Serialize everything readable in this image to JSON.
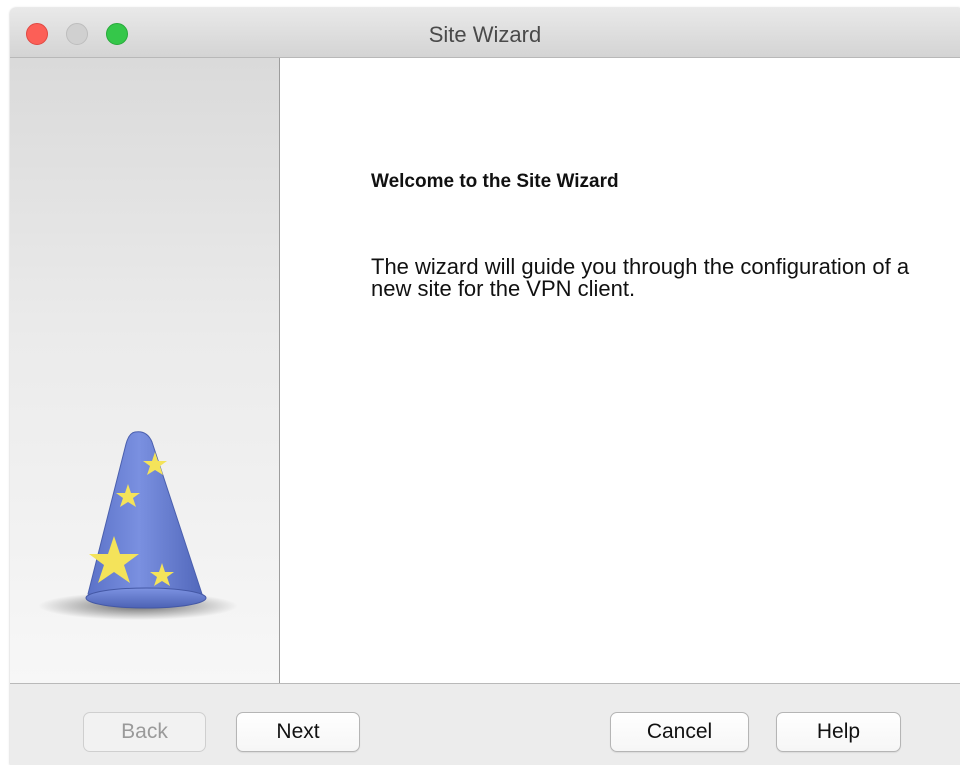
{
  "window": {
    "title": "Site Wizard"
  },
  "side_panel": {
    "illustration": "wizard-hat-icon"
  },
  "main": {
    "heading": "Welcome to the Site Wizard",
    "description": "The wizard will guide you through the configuration of a new site for the VPN client."
  },
  "buttons": {
    "back": "Back",
    "next": "Next",
    "cancel": "Cancel",
    "help": "Help"
  },
  "colors": {
    "close": "#fc5f57",
    "minimize": "#d0d0d0",
    "zoom": "#35c74a",
    "hat_blue": "#6f86d8",
    "hat_stars": "#f4e35a"
  }
}
